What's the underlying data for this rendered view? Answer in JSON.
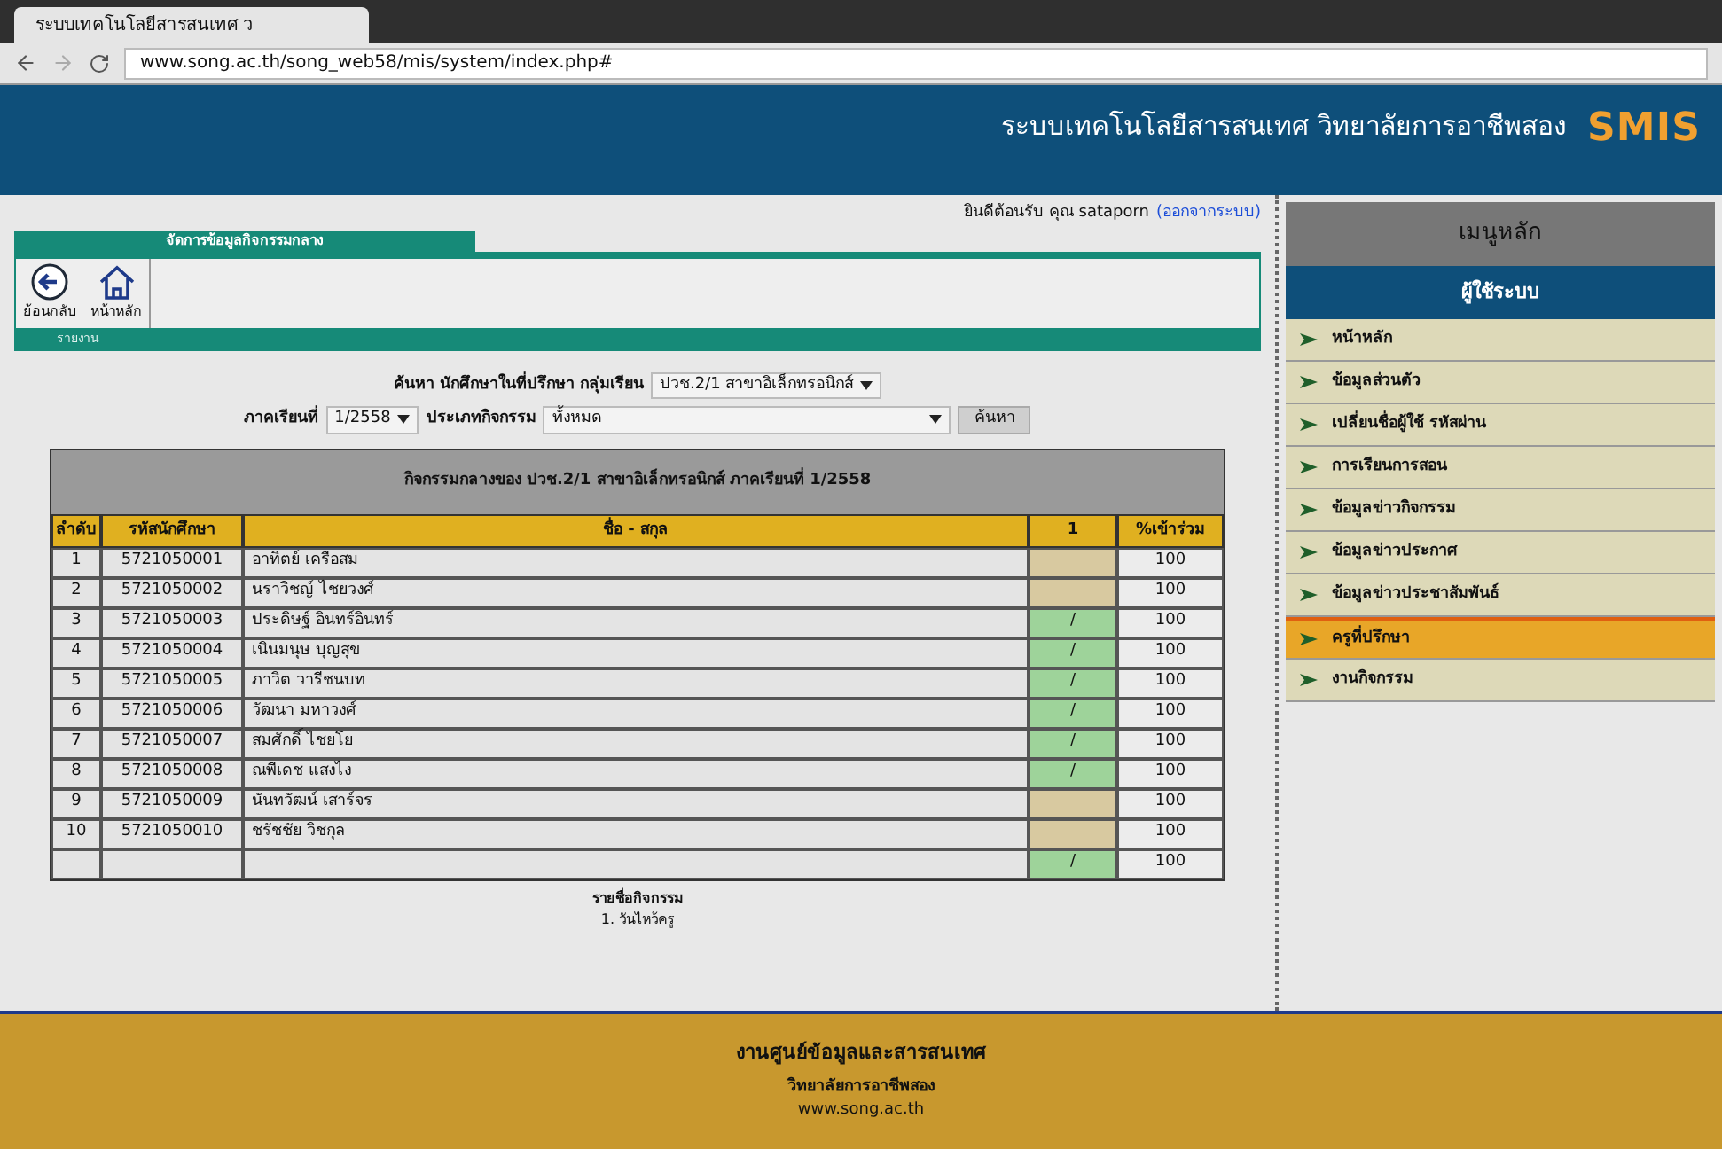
{
  "browser": {
    "tab_title": "ระบบเทคโนโลยีสารสนเทศ ว",
    "url": "www.song.ac.th/song_web58/mis/system/index.php#"
  },
  "header": {
    "title": "ระบบเทคโนโลยีสารสนเทศ วิทยาลัยการอาชีพสอง",
    "logo": "SMIS"
  },
  "welcome": {
    "text": "ยินดีต้อนรับ คุณ sataporn",
    "logout": "(ออกจากระบบ)"
  },
  "section_tab": "จัดการข้อมูลกิจกรรมกลาง",
  "toolbar": [
    {
      "kind": "back",
      "label": "ย้อนกลับ"
    },
    {
      "kind": "home",
      "label": "หน้าหลัก"
    }
  ],
  "bar_label": "รายงาน",
  "search": {
    "group_label": "ค้นหา นักศึกษาในที่ปรึกษา กลุ่มเรียน",
    "group": "ปวช.2/1 สาขาอิเล็กทรอนิกส์",
    "term_label": "ภาคเรียนที่",
    "term": "1/2558",
    "type_label": "ประเภทกิจกรรม",
    "type": "ทั้งหมด",
    "button": "ค้นหา"
  },
  "table": {
    "title": "กิจกรรมกลางของ ปวช.2/1 สาขาอิเล็กทรอนิกส์ ภาคเรียนที่ 1/2558",
    "columns": [
      "ลำดับ",
      "รหัสนักศึกษา",
      "ชื่อ - สกุล",
      "1",
      "%เข้าร่วม"
    ],
    "rows": [
      {
        "no": "1",
        "id": "5721050001",
        "name": "อาทิตย์ เครือสม",
        "attended": false,
        "percent": "100"
      },
      {
        "no": "2",
        "id": "5721050002",
        "name": "นราวิชญ์ ไชยวงศ์",
        "attended": false,
        "percent": "100"
      },
      {
        "no": "3",
        "id": "5721050003",
        "name": "ประดิษฐ์ อินทร์อินทร์",
        "attended": true,
        "mark": "/",
        "percent": "100"
      },
      {
        "no": "4",
        "id": "5721050004",
        "name": "เนินมนุษ บุญสุข",
        "attended": true,
        "mark": "/",
        "percent": "100"
      },
      {
        "no": "5",
        "id": "5721050005",
        "name": "ภาวิต วารีชนบท",
        "attended": true,
        "mark": "/",
        "percent": "100"
      },
      {
        "no": "6",
        "id": "5721050006",
        "name": "วัฒนา มหาวงศ์",
        "attended": true,
        "mark": "/",
        "percent": "100"
      },
      {
        "no": "7",
        "id": "5721050007",
        "name": "สมศักดิ์ ไชยโย",
        "attended": true,
        "mark": "/",
        "percent": "100"
      },
      {
        "no": "8",
        "id": "5721050008",
        "name": "ณพีเดช แสงไง",
        "attended": true,
        "mark": "/",
        "percent": "100"
      },
      {
        "no": "9",
        "id": "5721050009",
        "name": "นันทวัฒน์ เสาร์จร",
        "attended": false,
        "percent": "100"
      },
      {
        "no": "10",
        "id": "5721050010",
        "name": "ชรัชชัย วิชกุล",
        "attended": false,
        "percent": "100"
      },
      {
        "attended": true,
        "mark": "/",
        "percent": "100"
      }
    ]
  },
  "activities": {
    "title": "รายชื่อกิจกรรม",
    "items": [
      "1. วันไหว้ครู"
    ]
  },
  "footer": {
    "title": "งานศูนย์ข้อมูลและสารสนเทศ",
    "college": "วิทยาลัยการอาชีพสอง",
    "site": "www.song.ac.th"
  },
  "sidebar": {
    "title": "เมนูหลัก",
    "section": "ผู้ใช้ระบบ",
    "items": [
      {
        "label": "หน้าหลัก",
        "selected": false
      },
      {
        "label": "ข้อมูลส่วนตัว",
        "selected": false
      },
      {
        "label": "เปลี่ยนชื่อผู้ใช้ รหัสผ่าน",
        "selected": false
      },
      {
        "label": "การเรียนการสอน",
        "selected": false
      },
      {
        "label": "ข้อมูลข่าวกิจกรรม",
        "selected": false
      },
      {
        "label": "ข้อมูลข่าวประกาศ",
        "selected": false
      },
      {
        "label": "ข้อมูลข่าวประชาสัมพันธ์",
        "selected": false
      },
      {
        "label": "ครูที่ปรึกษา",
        "selected": true
      },
      {
        "label": "งานกิจกรรม",
        "selected": false
      }
    ]
  }
}
